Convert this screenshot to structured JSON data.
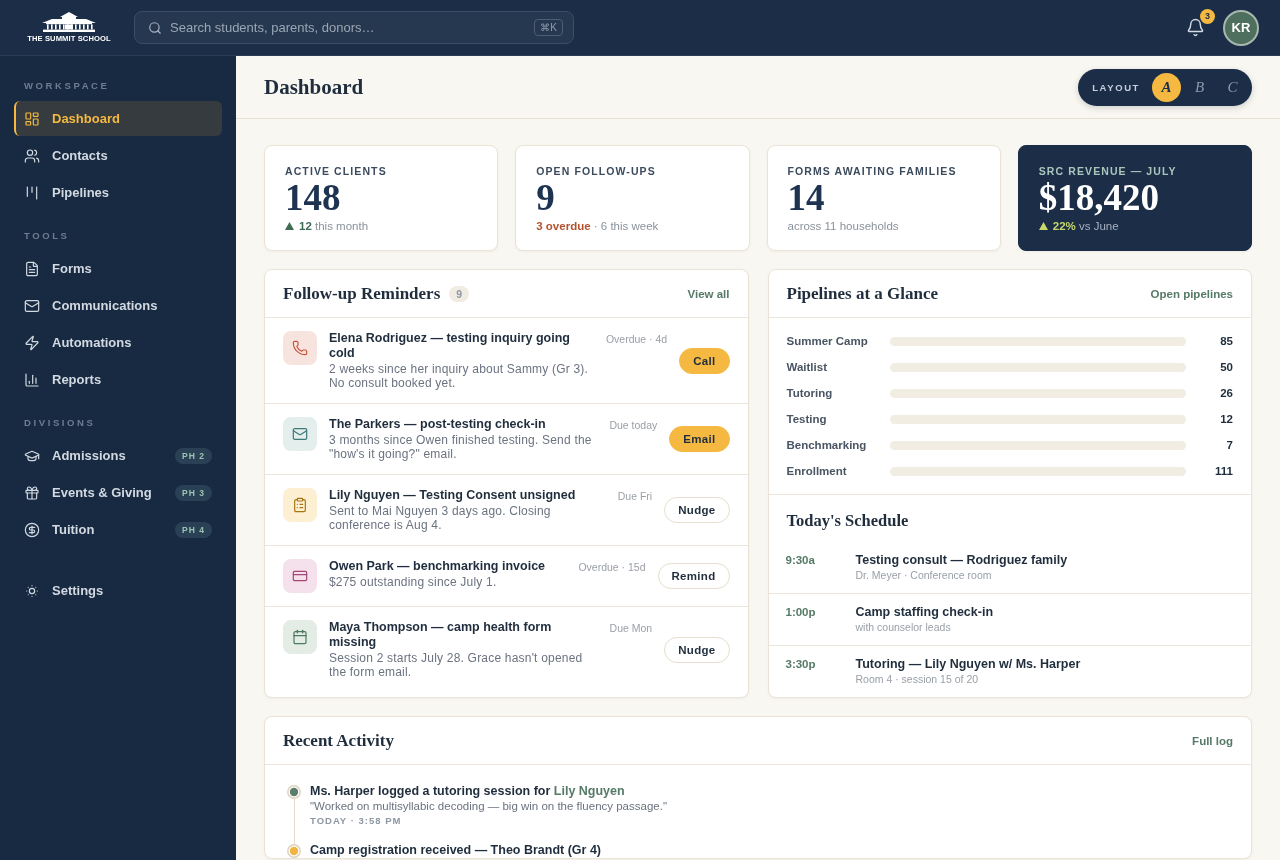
{
  "topbar": {
    "logo_text": "THE SUMMIT SCHOOL",
    "search": {
      "placeholder": "Search students, parents, donors…",
      "shortcut": "⌘K"
    },
    "notifications": {
      "count": "3"
    },
    "avatar": {
      "initials": "KR"
    }
  },
  "sidebar": {
    "sections": [
      {
        "title": "WORKSPACE",
        "items": [
          {
            "kind": "dashboard",
            "label": "Dashboard",
            "selected": true
          },
          {
            "kind": "contacts",
            "label": "Contacts",
            "selected": false
          },
          {
            "kind": "pipelines",
            "label": "Pipelines",
            "selected": false
          }
        ]
      },
      {
        "title": "TOOLS",
        "items": [
          {
            "kind": "forms",
            "label": "Forms",
            "selected": false
          },
          {
            "kind": "communications",
            "label": "Communications",
            "selected": false
          },
          {
            "kind": "automations",
            "label": "Automations",
            "selected": false
          },
          {
            "kind": "reports",
            "label": "Reports",
            "selected": false
          }
        ]
      },
      {
        "title": "DIVISIONS",
        "items": [
          {
            "kind": "admissions",
            "label": "Admissions",
            "badge": "PH 2",
            "selected": false
          },
          {
            "kind": "events",
            "label": "Events & Giving",
            "badge": "PH 3",
            "selected": false
          },
          {
            "kind": "tuition",
            "label": "Tuition",
            "badge": "PH 4",
            "selected": false
          }
        ]
      },
      {
        "items": [
          {
            "kind": "settings",
            "label": "Settings",
            "selected": false
          }
        ]
      }
    ]
  },
  "header": {
    "title": "Dashboard",
    "layout_switcher": {
      "label": "LAYOUT",
      "options": [
        {
          "label": "A",
          "selected": true
        },
        {
          "label": "B",
          "selected": false
        },
        {
          "label": "C",
          "selected": false
        }
      ]
    }
  },
  "stats": [
    {
      "label": "ACTIVE CLIENTS",
      "value": "148",
      "featured": false,
      "note": {
        "rising": true,
        "emphasis": "12",
        "alert": false,
        "text": "this month"
      }
    },
    {
      "label": "OPEN FOLLOW-UPS",
      "value": "9",
      "featured": false,
      "note": {
        "rising": false,
        "emphasis": "3 overdue",
        "alert": true,
        "text": "· 6 this week"
      }
    },
    {
      "label": "FORMS AWAITING FAMILIES",
      "value": "14",
      "featured": false,
      "note": {
        "rising": false,
        "text": "across 11 households"
      }
    },
    {
      "label": "SRC REVENUE — JULY",
      "value": "$18,420",
      "featured": true,
      "note": {
        "rising": true,
        "emphasis": "22%",
        "alert": false,
        "text": "vs June"
      }
    }
  ],
  "reminders": {
    "title": "Follow-up Reminders",
    "count": "9",
    "link": "View all",
    "items": [
      {
        "kind": "call",
        "title": "Elena Rodriguez — testing inquiry going cold",
        "detail": "2 weeks since her inquiry about Sammy (Gr 3). No consult booked yet.",
        "due": "Overdue · 4d",
        "action": {
          "label": "Call",
          "primary": true
        }
      },
      {
        "kind": "email",
        "title": "The Parkers — post-testing check-in",
        "detail": "3 months since Owen finished testing. Send the \"how's it going?\" email.",
        "due": "Due today",
        "action": {
          "label": "Email",
          "primary": true
        }
      },
      {
        "kind": "consent",
        "title": "Lily Nguyen — Testing Consent unsigned",
        "detail": "Sent to Mai Nguyen 3 days ago. Closing conference is Aug 4.",
        "due": "Due Fri",
        "action": {
          "label": "Nudge",
          "primary": false
        }
      },
      {
        "kind": "invoice",
        "title": "Owen Park — benchmarking invoice",
        "detail": "$275 outstanding since July 1.",
        "due": "Overdue · 15d",
        "action": {
          "label": "Remind",
          "primary": false
        }
      },
      {
        "kind": "form",
        "title": "Maya Thompson — camp health form missing",
        "detail": "Session 2 starts July 28. Grace hasn't opened the form email.",
        "due": "Due Mon",
        "action": {
          "label": "Nudge",
          "primary": false
        }
      }
    ]
  },
  "pipelines": {
    "title": "Pipelines at a Glance",
    "link": "Open pipelines",
    "rows": [
      {
        "name": "Summer Camp",
        "count": "85"
      },
      {
        "name": "Waitlist",
        "count": "50"
      },
      {
        "name": "Tutoring",
        "count": "26"
      },
      {
        "name": "Testing",
        "count": "12"
      },
      {
        "name": "Benchmarking",
        "count": "7"
      },
      {
        "name": "Enrollment",
        "count": "111"
      }
    ]
  },
  "schedule": {
    "title": "Today's Schedule",
    "items": [
      {
        "time": "9:30a",
        "title": "Testing consult — Rodriguez family",
        "detail": "Dr. Meyer · Conference room"
      },
      {
        "time": "1:00p",
        "title": "Camp staffing check-in",
        "detail": "with counselor leads"
      },
      {
        "time": "3:30p",
        "title": "Tutoring — Lily Nguyen w/ Ms. Harper",
        "detail": "Room 4 · session 15 of 20"
      }
    ]
  },
  "activity": {
    "title": "Recent Activity",
    "link": "Full log",
    "items": [
      {
        "color": "#5b7d6b",
        "text": "Ms. Harper logged a tutoring session for",
        "link": "Lily Nguyen",
        "quote": "\"Worked on multisyllabic decoding — big win on the fluency passage.\"",
        "time": "TODAY · 3:58 PM"
      },
      {
        "color": "#f2b441",
        "text": "Camp registration received — Theo Brandt (Gr 4)"
      }
    ]
  }
}
